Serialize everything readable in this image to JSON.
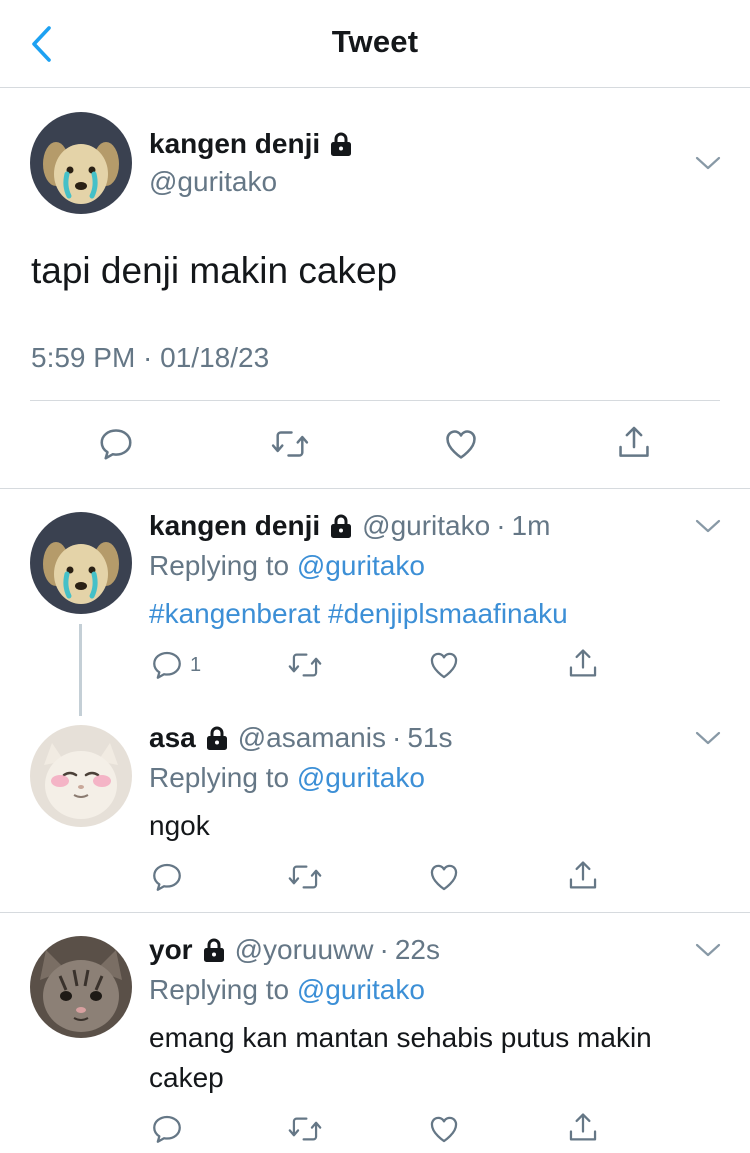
{
  "header": {
    "title": "Tweet",
    "back_icon": "chevron-left-icon"
  },
  "main_tweet": {
    "name": "kangen denji",
    "handle": "@guritako",
    "text": "tapi denji makin cakep",
    "timestamp": "5:59 PM · 01/18/23",
    "locked": true
  },
  "replies": [
    {
      "name": "kangen denji",
      "handle": "@guritako",
      "separator": "·",
      "time": "1m",
      "replying_prefix": "Replying to",
      "replying_to": "@guritako",
      "hashtags": [
        "#kangenberat",
        "#denjiplsmaafinaku"
      ],
      "reply_count": "1"
    },
    {
      "name": "asa",
      "handle": "@asamanis",
      "separator": "·",
      "time": "51s",
      "replying_prefix": "Replying to",
      "replying_to": "@guritako",
      "text": "ngok"
    },
    {
      "name": "yor",
      "handle": "@yoruuww",
      "separator": "·",
      "time": "22s",
      "replying_prefix": "Replying to",
      "replying_to": "@guritako",
      "text": "emang kan mantan sehabis putus makin cakep"
    }
  ],
  "colors": {
    "accent": "#1da1f2",
    "link": "#3c8fd6",
    "muted": "#657786",
    "divider": "#d6dade"
  }
}
